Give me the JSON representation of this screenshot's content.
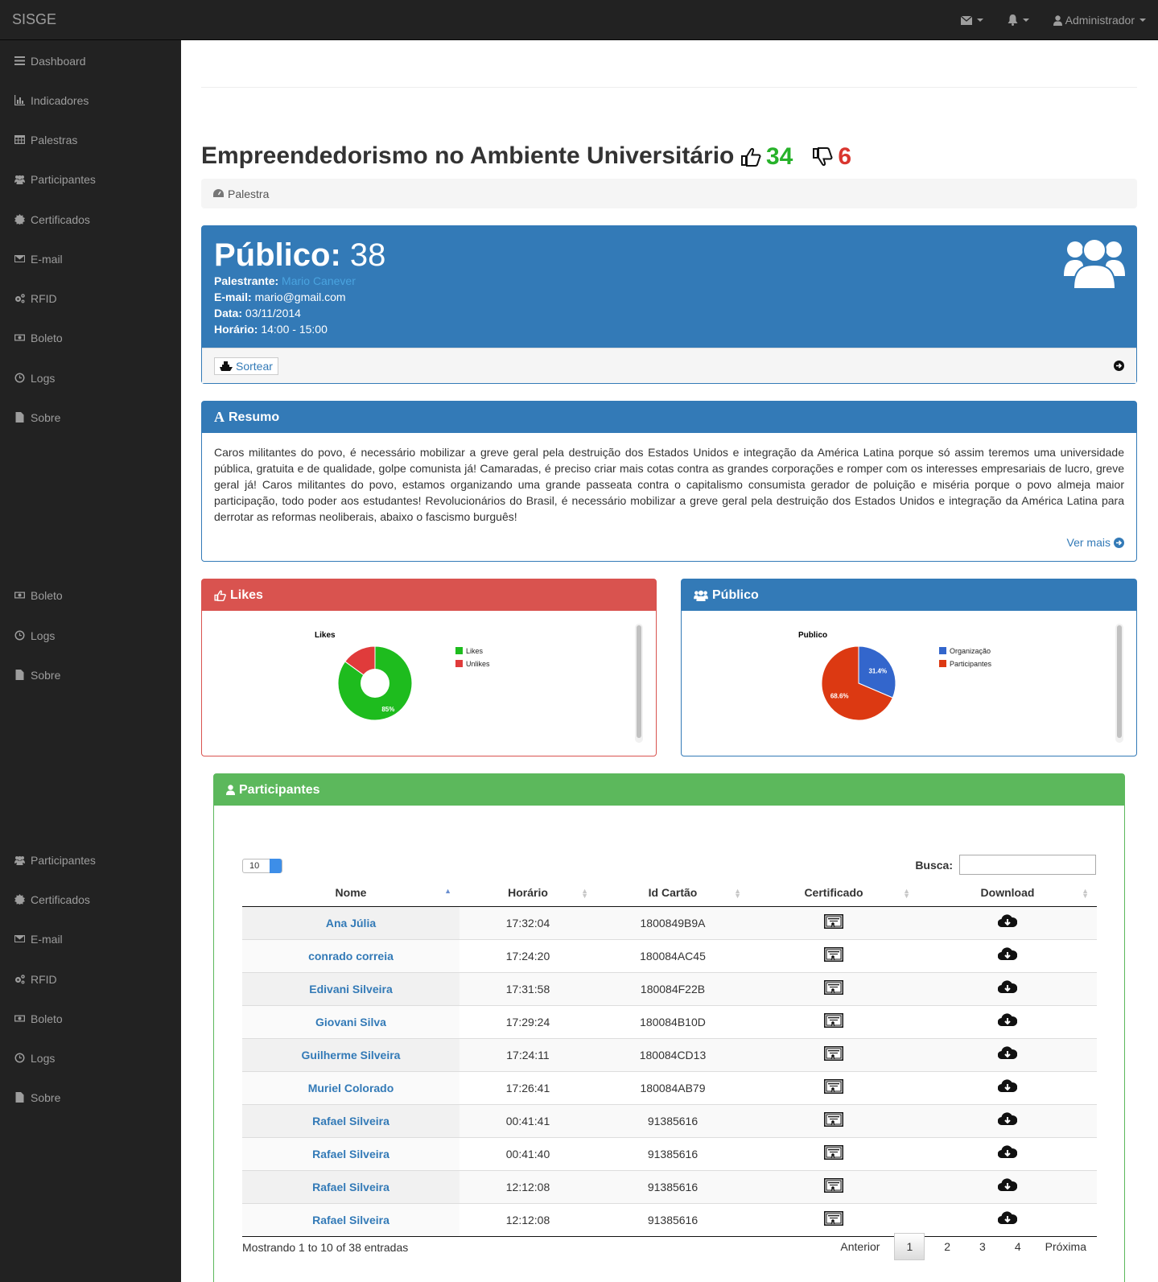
{
  "navbar": {
    "brand": "SISGE",
    "user": "Administrador"
  },
  "sidebar": [
    {
      "label": "Dashboard",
      "icon": "dashboard-icon"
    },
    {
      "label": "Indicadores",
      "icon": "bar-chart-icon"
    },
    {
      "label": "Palestras",
      "icon": "table-icon"
    },
    {
      "label": "Participantes",
      "icon": "users-icon"
    },
    {
      "label": "Certificados",
      "icon": "certificate-icon"
    },
    {
      "label": "E-mail",
      "icon": "envelope-icon"
    },
    {
      "label": "RFID",
      "icon": "cogs-icon"
    },
    {
      "label": "Boleto",
      "icon": "money-icon"
    },
    {
      "label": "Logs",
      "icon": "clock-icon"
    },
    {
      "label": "Sobre",
      "icon": "file-icon"
    },
    {
      "label": "Boleto",
      "icon": "money-icon"
    },
    {
      "label": "Logs",
      "icon": "clock-icon"
    },
    {
      "label": "Sobre",
      "icon": "file-icon"
    },
    {
      "label": "Participantes",
      "icon": "users-icon"
    },
    {
      "label": "Certificados",
      "icon": "certificate-icon"
    },
    {
      "label": "E-mail",
      "icon": "envelope-icon"
    },
    {
      "label": "RFID",
      "icon": "cogs-icon"
    },
    {
      "label": "Boleto",
      "icon": "money-icon"
    },
    {
      "label": "Logs",
      "icon": "clock-icon"
    },
    {
      "label": "Sobre",
      "icon": "file-icon"
    }
  ],
  "header": {
    "title": "Empreendedorismo no Ambiente Universitário",
    "likes": "34",
    "unlikes": "6",
    "breadcrumb": "Palestra"
  },
  "publico": {
    "label": "Público:",
    "count": "38",
    "speaker_label": "Palestrante:",
    "speaker": "Mario Canever",
    "email_label": "E-mail:",
    "email": "mario@gmail.com",
    "date_label": "Data:",
    "date": "03/11/2014",
    "time_label": "Horário:",
    "time": "14:00 - 15:00",
    "sortear": "Sortear"
  },
  "resumo": {
    "title": "Resumo",
    "text": "Caros militantes do povo, é necessário mobilizar a greve geral pela destruição dos Estados Unidos e integração da América Latina porque só assim teremos uma universidade pública, gratuita e de qualidade, golpe comunista já! Camaradas, é preciso criar mais cotas contra as grandes corporações e romper com os interesses empresariais de lucro, greve geral já! Caros militantes do povo, estamos organizando uma grande passeata contra o capitalismo consumista gerador de poluição e miséria porque o povo almeja maior participação, todo poder aos estudantes! Revolucionários do Brasil, é necessário mobilizar a greve geral pela destruição dos Estados Unidos e integração da América Latina para derrotar as reformas neoliberais, abaixo o fascismo burguês!",
    "more": "Ver mais"
  },
  "likes_panel": {
    "title": "Likes"
  },
  "publico_panel": {
    "title": "Público"
  },
  "chart_data": [
    {
      "type": "pie",
      "variant": "donut",
      "title": "Likes",
      "labels": [
        "Likes",
        "Unlikes"
      ],
      "values": [
        85,
        15
      ],
      "colors": [
        "#1ebc1e",
        "#e03b3b"
      ],
      "data_labels": [
        "85%",
        ""
      ],
      "legend": "right"
    },
    {
      "type": "pie",
      "title": "Publico",
      "labels": [
        "Organização",
        "Participantes"
      ],
      "values": [
        31.4,
        68.6
      ],
      "colors": [
        "#3366cc",
        "#dc3912"
      ],
      "data_labels": [
        "31.4%",
        "68.6%"
      ],
      "legend": "right"
    }
  ],
  "participantes": {
    "title": "Participantes",
    "page_length": "10",
    "search_label": "Busca:",
    "columns": [
      "Nome",
      "Horário",
      "Id Cartão",
      "Certificado",
      "Download"
    ],
    "rows": [
      {
        "name": "Ana Júlia",
        "time": "17:32:04",
        "card": "1800849B9A"
      },
      {
        "name": "conrado correia",
        "time": "17:24:20",
        "card": "180084AC45"
      },
      {
        "name": "Edivani Silveira",
        "time": "17:31:58",
        "card": "180084F22B"
      },
      {
        "name": "Giovani Silva",
        "time": "17:29:24",
        "card": "180084B10D"
      },
      {
        "name": "Guilherme Silveira",
        "time": "17:24:11",
        "card": "180084CD13"
      },
      {
        "name": "Muriel Colorado",
        "time": "17:26:41",
        "card": "180084AB79"
      },
      {
        "name": "Rafael Silveira",
        "time": "00:41:41",
        "card": "91385616"
      },
      {
        "name": "Rafael Silveira",
        "time": "00:41:40",
        "card": "91385616"
      },
      {
        "name": "Rafael Silveira",
        "time": "12:12:08",
        "card": "91385616"
      },
      {
        "name": "Rafael Silveira",
        "time": "12:12:08",
        "card": "91385616"
      }
    ],
    "info": "Mostrando 1 to 10 of 38 entradas",
    "pager": {
      "prev": "Anterior",
      "pages": [
        "1",
        "2",
        "3",
        "4"
      ],
      "next": "Próxima"
    }
  },
  "colors": {
    "primary": "#337ab7",
    "danger": "#d9534f",
    "success": "#5cb85c",
    "like": "#27b22a",
    "unlike": "#d9362f"
  }
}
